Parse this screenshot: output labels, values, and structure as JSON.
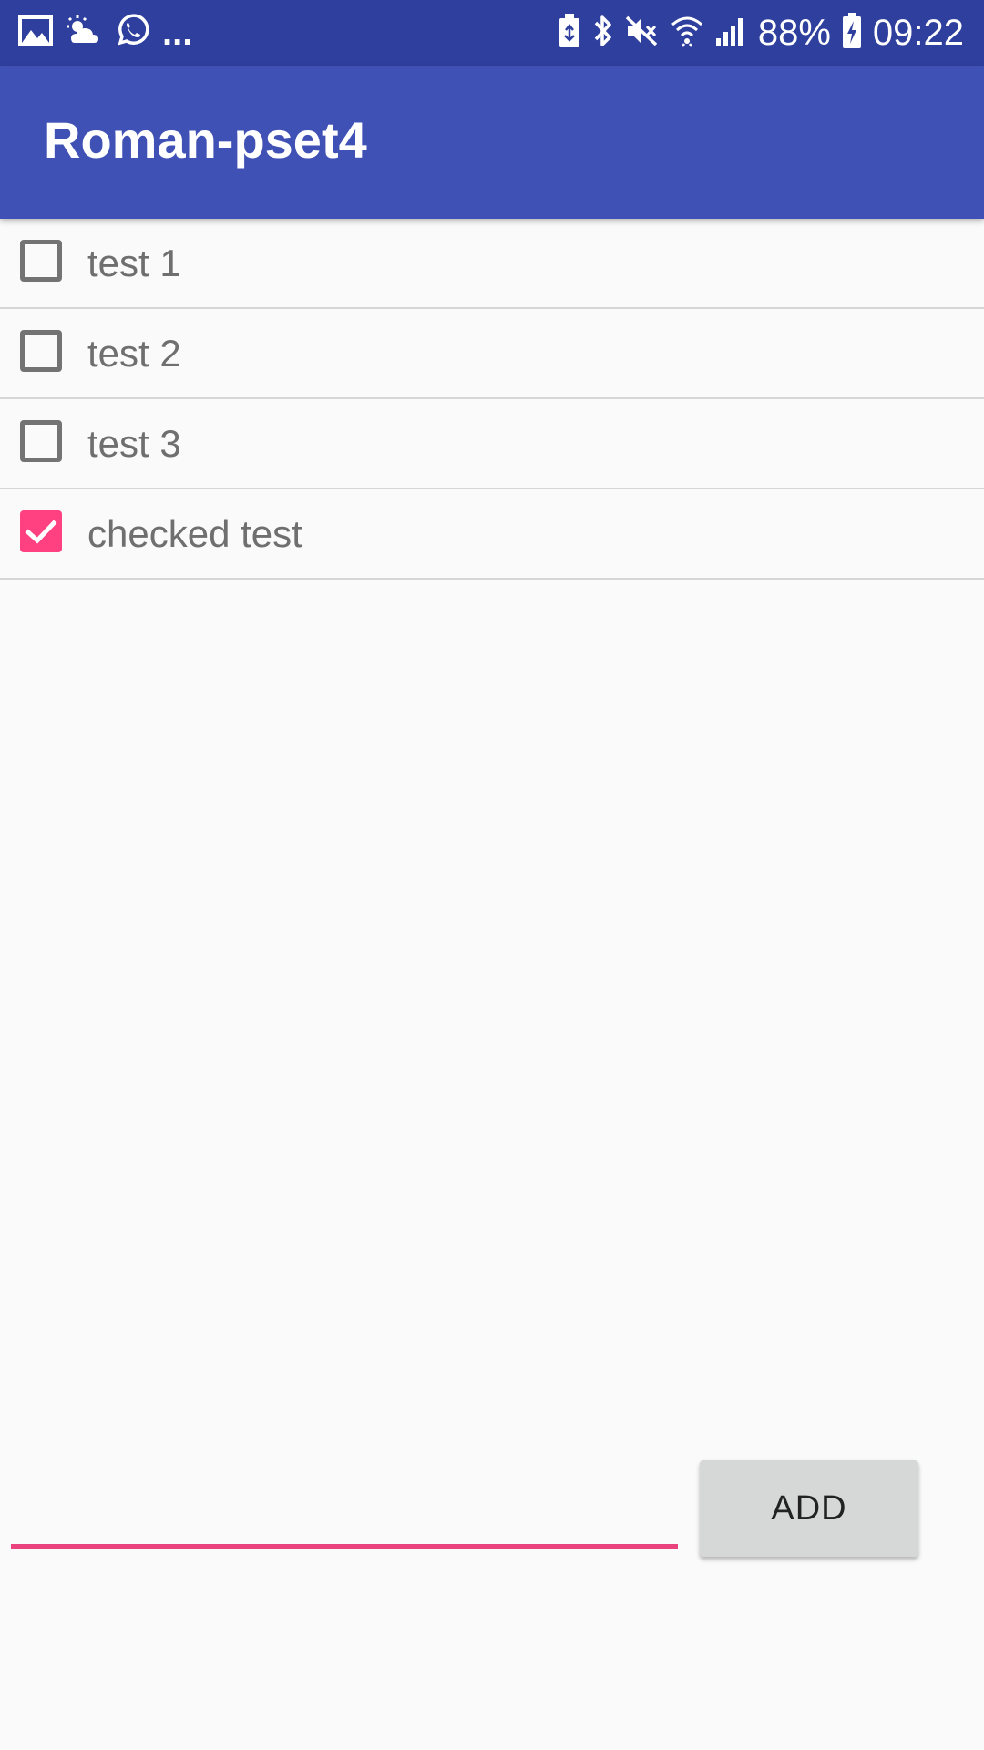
{
  "status_bar": {
    "left_icons": [
      "gallery-icon",
      "partly-cloudy-icon",
      "whatsapp-icon"
    ],
    "overflow": "...",
    "right_icons": [
      "battery-saver-icon",
      "bluetooth-icon",
      "mute-icon",
      "wifi-icon",
      "signal-icon"
    ],
    "battery_percent": "88%",
    "time": "09:22"
  },
  "app_bar": {
    "title": "Roman-pset4"
  },
  "todos": [
    {
      "label": "test 1",
      "checked": false
    },
    {
      "label": "test 2",
      "checked": false
    },
    {
      "label": "test 3",
      "checked": false
    },
    {
      "label": "checked test",
      "checked": true
    }
  ],
  "input": {
    "value": "",
    "placeholder": ""
  },
  "add_button": {
    "label": "ADD"
  },
  "colors": {
    "status_bar": "#2f3f9e",
    "primary": "#3f51b5",
    "accent": "#ff4081",
    "background": "#fafafa"
  }
}
